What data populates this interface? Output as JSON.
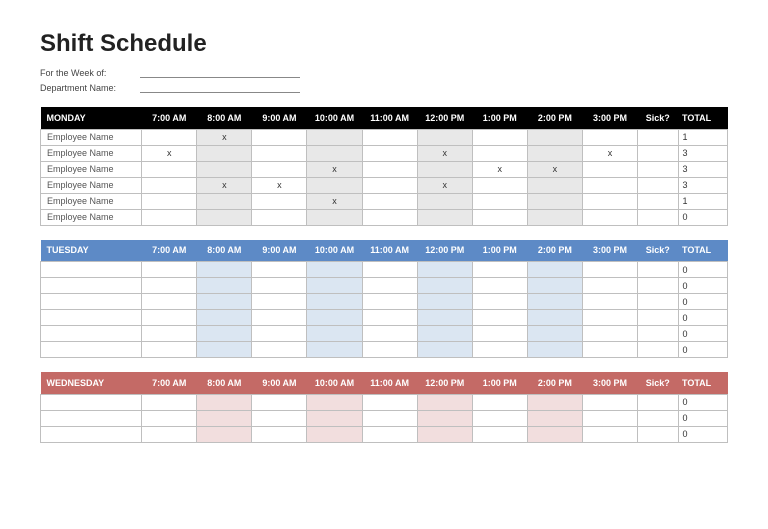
{
  "title": "Shift Schedule",
  "meta": {
    "week_label": "For the Week of:",
    "week_value": "",
    "dept_label": "Department Name:",
    "dept_value": ""
  },
  "columns": {
    "hours": [
      "7:00 AM",
      "8:00 AM",
      "9:00 AM",
      "10:00 AM",
      "11:00 AM",
      "12:00 PM",
      "1:00 PM",
      "2:00 PM",
      "3:00 PM"
    ],
    "sick": "Sick?",
    "total": "TOTAL"
  },
  "days": [
    {
      "name": "MONDAY",
      "header_class": "hdr-black",
      "shade_class": "shade-grey",
      "rows": [
        {
          "name": "Employee Name",
          "cells": [
            "",
            "x",
            "",
            "",
            "",
            "",
            "",
            "",
            "",
            ""
          ],
          "total": "1"
        },
        {
          "name": "Employee Name",
          "cells": [
            "x",
            "",
            "",
            "",
            "",
            "x",
            "",
            "",
            "x",
            ""
          ],
          "total": "3"
        },
        {
          "name": "Employee Name",
          "cells": [
            "",
            "",
            "",
            "x",
            "",
            "",
            "x",
            "x",
            "",
            ""
          ],
          "total": "3"
        },
        {
          "name": "Employee Name",
          "cells": [
            "",
            "x",
            "x",
            "",
            "",
            "x",
            "",
            "",
            "",
            ""
          ],
          "total": "3"
        },
        {
          "name": "Employee Name",
          "cells": [
            "",
            "",
            "",
            "x",
            "",
            "",
            "",
            "",
            "",
            ""
          ],
          "total": "1"
        },
        {
          "name": "Employee Name",
          "cells": [
            "",
            "",
            "",
            "",
            "",
            "",
            "",
            "",
            "",
            ""
          ],
          "total": "0"
        }
      ]
    },
    {
      "name": "TUESDAY",
      "header_class": "hdr-blue",
      "shade_class": "shade-blue",
      "rows": [
        {
          "name": "",
          "cells": [
            "",
            "",
            "",
            "",
            "",
            "",
            "",
            "",
            "",
            ""
          ],
          "total": "0"
        },
        {
          "name": "",
          "cells": [
            "",
            "",
            "",
            "",
            "",
            "",
            "",
            "",
            "",
            ""
          ],
          "total": "0"
        },
        {
          "name": "",
          "cells": [
            "",
            "",
            "",
            "",
            "",
            "",
            "",
            "",
            "",
            ""
          ],
          "total": "0"
        },
        {
          "name": "",
          "cells": [
            "",
            "",
            "",
            "",
            "",
            "",
            "",
            "",
            "",
            ""
          ],
          "total": "0"
        },
        {
          "name": "",
          "cells": [
            "",
            "",
            "",
            "",
            "",
            "",
            "",
            "",
            "",
            ""
          ],
          "total": "0"
        },
        {
          "name": "",
          "cells": [
            "",
            "",
            "",
            "",
            "",
            "",
            "",
            "",
            "",
            ""
          ],
          "total": "0"
        }
      ]
    },
    {
      "name": "WEDNESDAY",
      "header_class": "hdr-red",
      "shade_class": "shade-red",
      "rows": [
        {
          "name": "",
          "cells": [
            "",
            "",
            "",
            "",
            "",
            "",
            "",
            "",
            "",
            ""
          ],
          "total": "0"
        },
        {
          "name": "",
          "cells": [
            "",
            "",
            "",
            "",
            "",
            "",
            "",
            "",
            "",
            ""
          ],
          "total": "0"
        },
        {
          "name": "",
          "cells": [
            "",
            "",
            "",
            "",
            "",
            "",
            "",
            "",
            "",
            ""
          ],
          "total": "0"
        }
      ]
    }
  ]
}
